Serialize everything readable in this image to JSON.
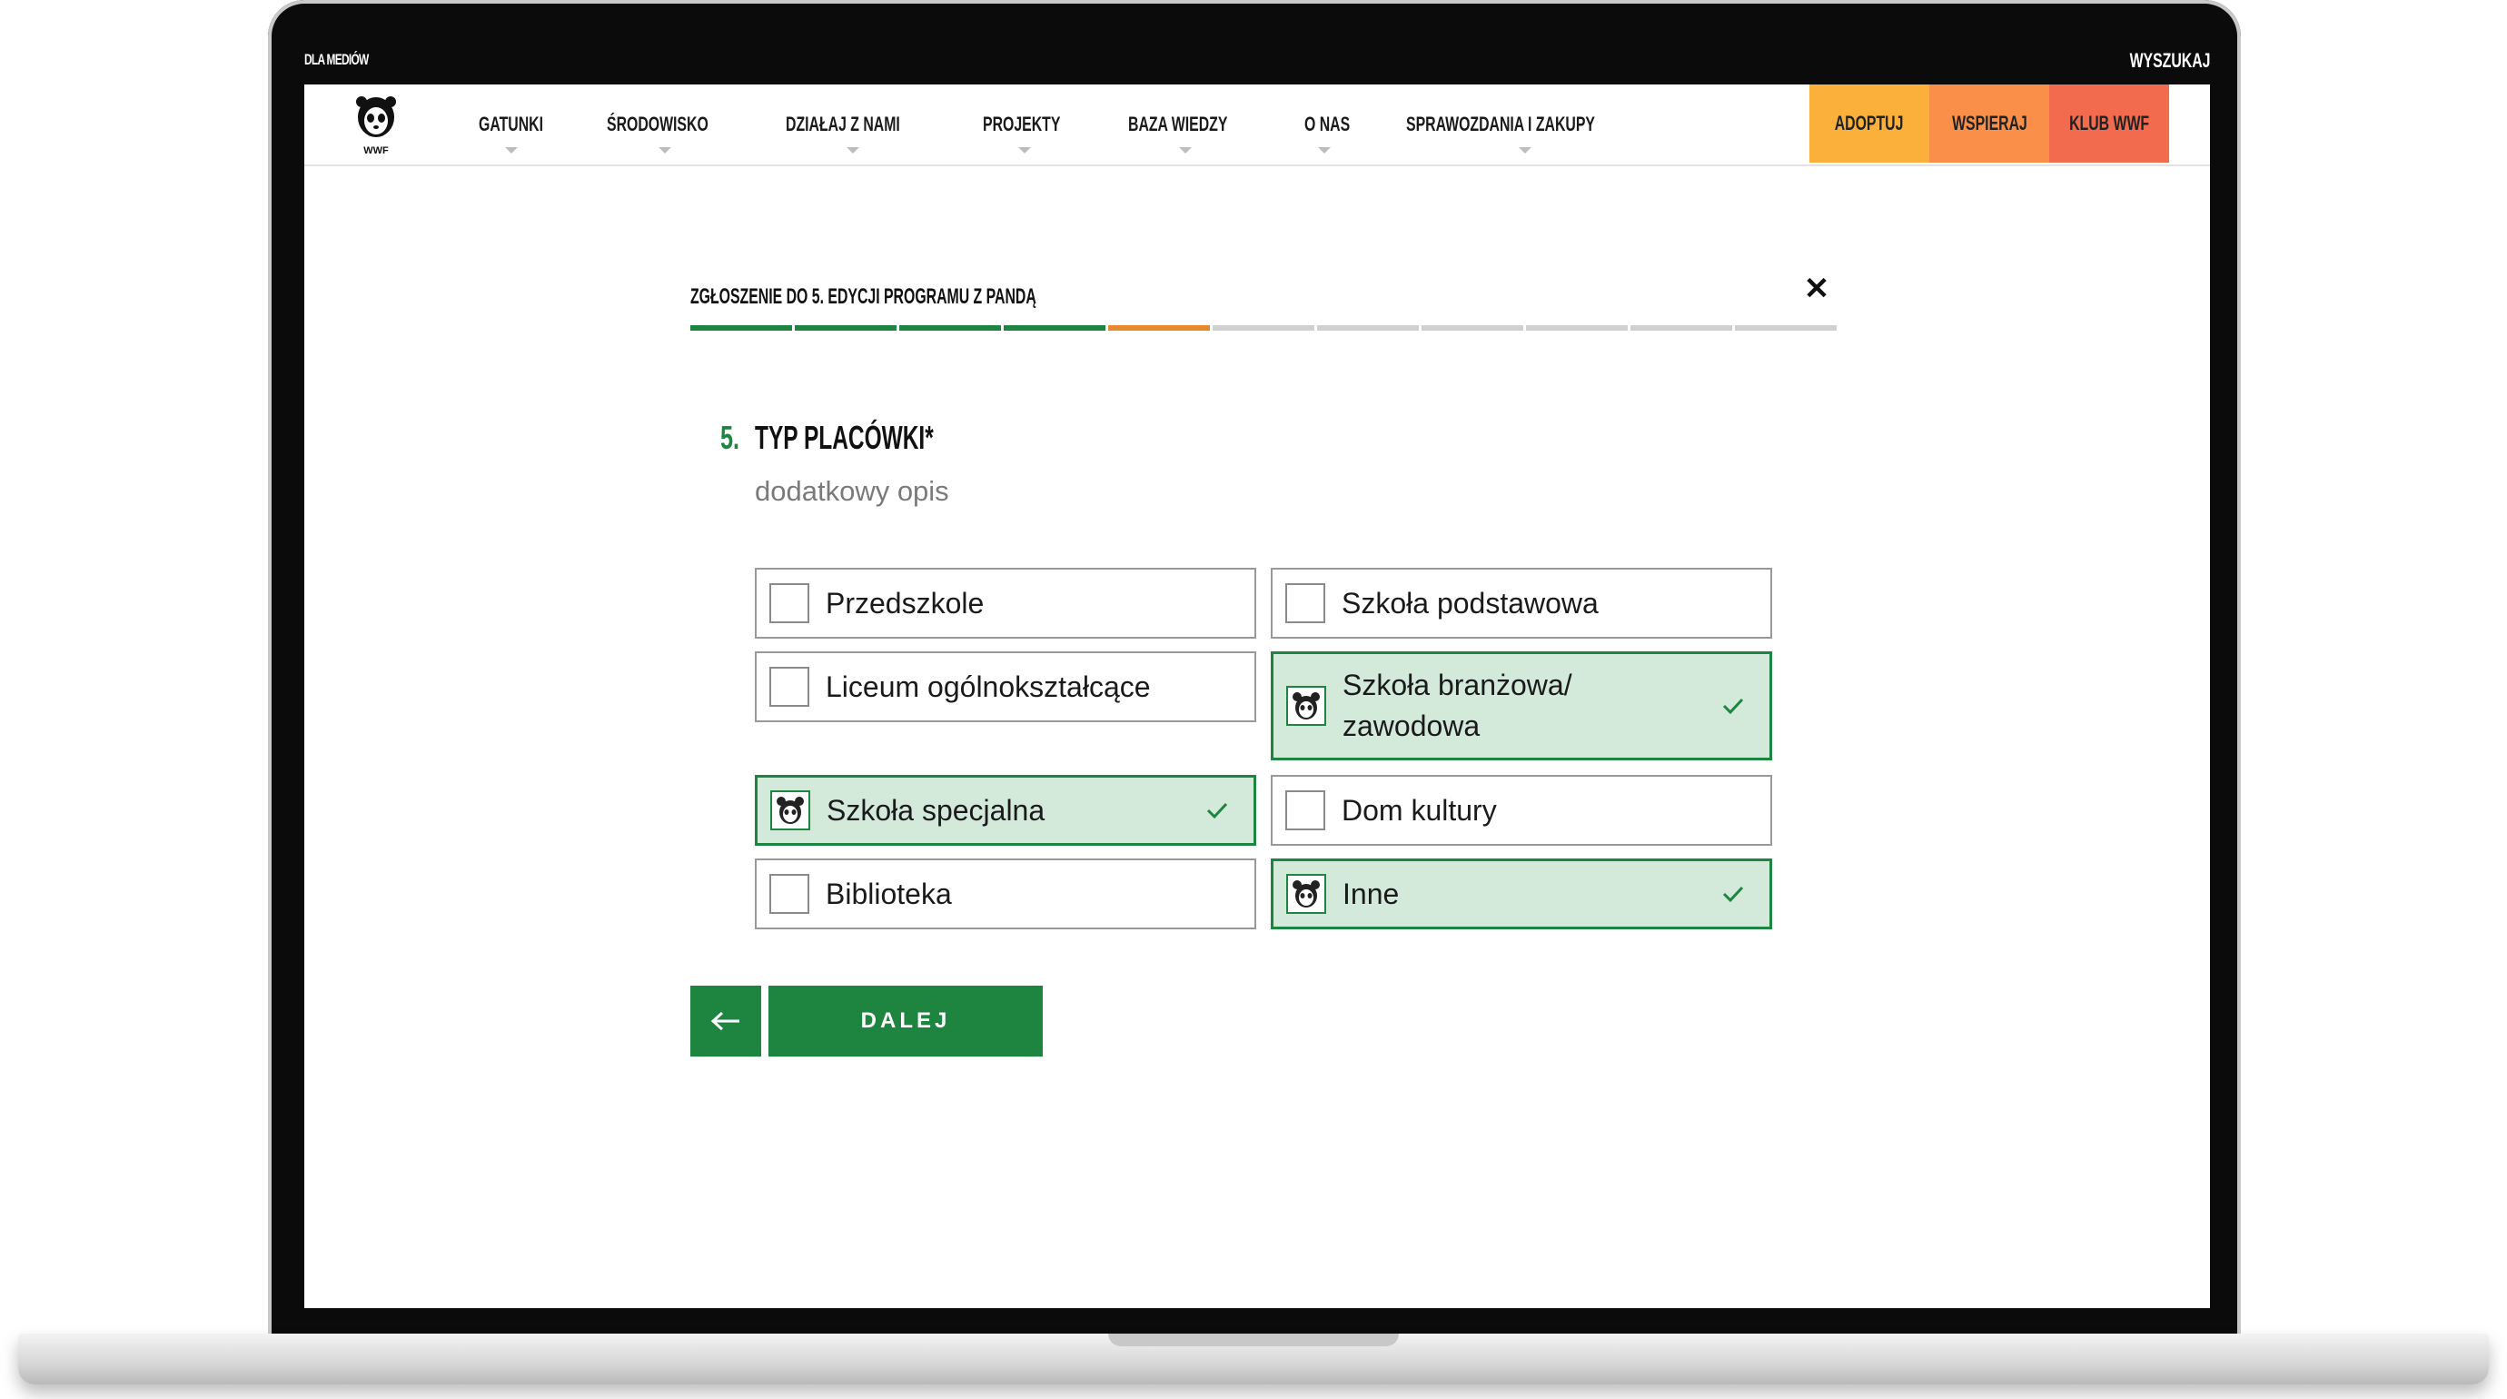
{
  "topbar": {
    "media_link": "DLA MEDIÓW",
    "search_link": "WYSZUKAJ"
  },
  "logo": {
    "text": "WWF"
  },
  "nav": {
    "items": [
      {
        "label": "GATUNKI",
        "dropdown": true
      },
      {
        "label": "ŚRODOWISKO",
        "dropdown": true
      },
      {
        "label": "DZIAŁAJ Z NAMI",
        "dropdown": true
      },
      {
        "label": "PROJEKTY",
        "dropdown": true
      },
      {
        "label": "BAZA WIEDZY",
        "dropdown": true
      },
      {
        "label": "O NAS",
        "dropdown": true
      },
      {
        "label": "SPRAWOZDANIA I ZAKUPY",
        "dropdown": true
      }
    ],
    "cta": {
      "adoptuj": "ADOPTUJ",
      "wspieraj": "WSPIERAJ",
      "klub": "KLUB WWF"
    }
  },
  "form": {
    "title": "ZGŁOSZENIE DO 5. EDYCJI PROGRAMU Z PANDĄ",
    "close": "✕",
    "progress": {
      "total_steps": 11,
      "completed": 4,
      "current": 5
    },
    "question": {
      "number": "5.",
      "title": "TYP PLACÓWKI*",
      "description": "dodatkowy opis"
    },
    "options": [
      {
        "label": "Przedszkole",
        "selected": false
      },
      {
        "label": "Szkoła podstawowa",
        "selected": false
      },
      {
        "label": "Liceum ogólnokształcące",
        "selected": false
      },
      {
        "label": "Szkoła branżowa/ zawodowa",
        "selected": true
      },
      {
        "label": "Szkoła specjalna",
        "selected": true
      },
      {
        "label": "Dom kultury",
        "selected": false
      },
      {
        "label": "Biblioteka",
        "selected": false
      },
      {
        "label": "Inne",
        "selected": true
      }
    ],
    "next_label": "DALEJ"
  },
  "colors": {
    "green": "#1e8540",
    "selected_bg": "#d3e9da",
    "progress_current": "#e9892e",
    "cta_adoptuj": "#fbb03b",
    "cta_wspieraj": "#fa8f4a",
    "cta_klub": "#f26b4f"
  },
  "icons": {
    "selected_box": "panda-icon",
    "selected_mark": "checkmark-icon",
    "back": "arrow-left-icon"
  }
}
